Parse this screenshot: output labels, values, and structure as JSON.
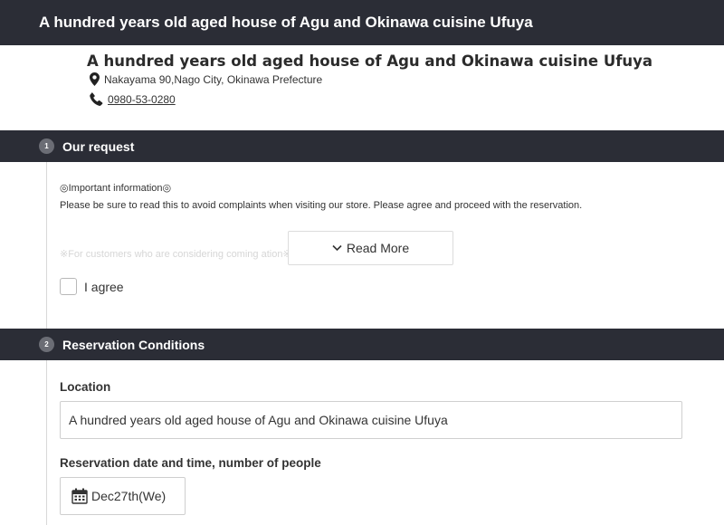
{
  "top_bar": {
    "title": "A hundred years old aged house of Agu and Okinawa cuisine Ufuya"
  },
  "shop": {
    "name": "A hundred years old aged house of Agu and Okinawa cuisine Ufuya",
    "address": "Nakayama 90,Nago City, Okinawa Prefecture",
    "phone": "0980-53-0280",
    "address_icon": "location-pin-icon",
    "phone_icon": "phone-icon"
  },
  "sections": [
    {
      "number": "1",
      "title": "Our request"
    },
    {
      "number": "2",
      "title": "Reservation Conditions"
    }
  ],
  "request": {
    "heading": "◎Important information◎",
    "body": "Please be sure to read this to avoid complaints when visiting our store. Please agree and proceed with the reservation.",
    "faded_line": "※For customers who are considering coming                                                          ation※",
    "read_more_label": "Read More",
    "agree_label": "I agree",
    "agree_checked": false
  },
  "conditions": {
    "location_label": "Location",
    "location_value": "A hundred years old aged house of Agu and Okinawa cuisine Ufuya",
    "date_label": "Reservation date and time, number of people",
    "date_value": "Dec27th(We)",
    "date_icon": "calendar-icon"
  },
  "colors": {
    "header_bg": "#2b2d36",
    "badge_bg": "#6b6d75",
    "border": "#cfcfcf"
  }
}
